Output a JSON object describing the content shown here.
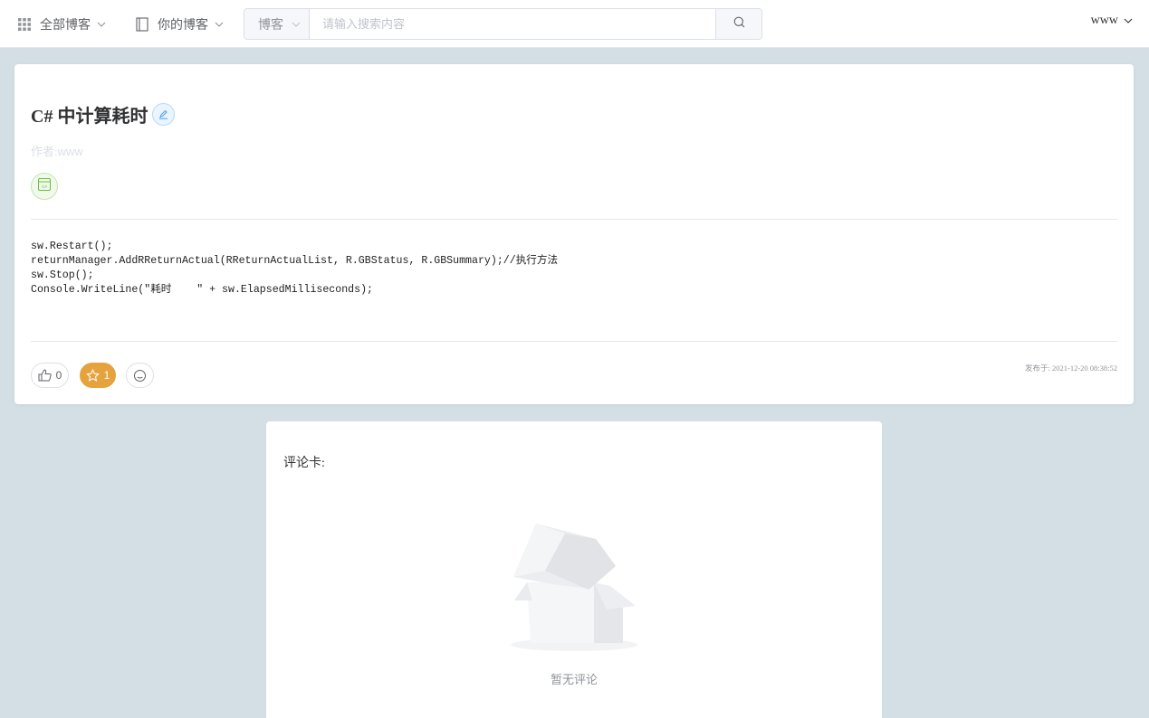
{
  "topbar": {
    "all_blogs": "全部博客",
    "my_blogs": "你的博客",
    "search": {
      "type": "博客",
      "placeholder": "请输入搜索内容"
    },
    "user": "www"
  },
  "article": {
    "title": "C# 中计算耗时",
    "author_label": "作者:",
    "author": "www",
    "tag_icon": "csharp-file-icon",
    "code": "sw.Restart();\nreturnManager.AddRReturnActual(RReturnActualList, R.GBStatus, R.GBSummary);//执行方法\nsw.Stop();\nConsole.WriteLine(\"耗时    \" + sw.ElapsedMilliseconds);",
    "likes": "0",
    "favorites": "1",
    "published": "发布于: 2021-12-20 08:38:52"
  },
  "comments": {
    "title": "评论卡:",
    "empty": "暂无评论"
  },
  "colors": {
    "background": "#d3dee5",
    "favorite_active": "#e6a23c",
    "edit_accent": "#409eff",
    "tag_green": "#67c23a"
  }
}
